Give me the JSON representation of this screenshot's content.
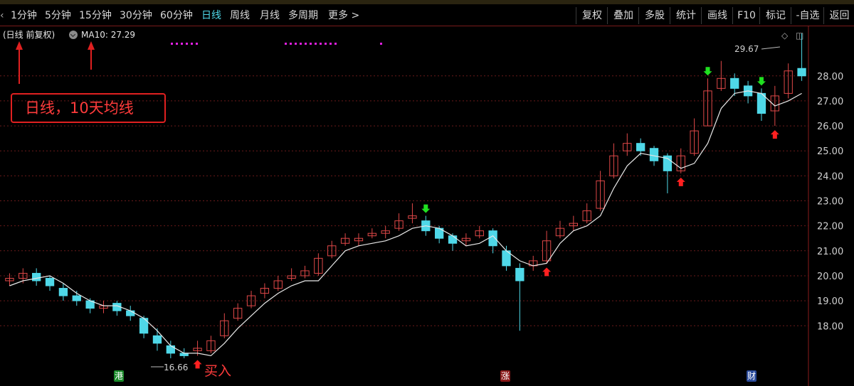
{
  "toolbar": {
    "periods": [
      {
        "label": "1分钟",
        "active": false
      },
      {
        "label": "5分钟",
        "active": false
      },
      {
        "label": "15分钟",
        "active": false
      },
      {
        "label": "30分钟",
        "active": false
      },
      {
        "label": "60分钟",
        "active": false
      },
      {
        "label": "日线",
        "active": true
      },
      {
        "label": "周线",
        "active": false
      },
      {
        "label": "月线",
        "active": false
      },
      {
        "label": "多周期",
        "active": false
      },
      {
        "label": "更多 >",
        "active": false
      }
    ],
    "tools": [
      "复权",
      "叠加",
      "多股",
      "统计",
      "画线",
      "F10",
      "标记",
      "-自选",
      "返回"
    ]
  },
  "chart_info": {
    "period_label": "(日线 前复权)",
    "ma_label": "MA10: 27.29"
  },
  "annotation": {
    "box_text": "日线，10天均线",
    "buy_text": "买入"
  },
  "markers": {
    "low_price": "16.66",
    "high_price": "29.67"
  },
  "badges": [
    {
      "text": "港",
      "color": "#1a8a2a"
    },
    {
      "text": "涨",
      "color": "#8a1a1a"
    },
    {
      "text": "财",
      "color": "#2a4a9a"
    }
  ],
  "colors": {
    "up": "#e04848",
    "down": "#4fd8e8",
    "ma": "#e8e8e8",
    "grid": "#6a1a1a",
    "buy_arrow": "#ff2020",
    "sell_arrow": "#20e020"
  },
  "chart_data": {
    "type": "candlestick",
    "y_ticks": [
      18.0,
      19.0,
      20.0,
      21.0,
      22.0,
      23.0,
      24.0,
      25.0,
      26.0,
      27.0,
      28.0
    ],
    "ylim": [
      16.3,
      29.9
    ],
    "series_ma": [
      19.6,
      19.8,
      19.9,
      20.0,
      19.7,
      19.3,
      19.0,
      18.8,
      18.8,
      18.6,
      18.3,
      17.8,
      17.2,
      16.9,
      16.9,
      16.8,
      17.3,
      17.9,
      18.4,
      18.9,
      19.3,
      19.6,
      19.8,
      19.8,
      20.4,
      21.0,
      21.2,
      21.3,
      21.4,
      21.6,
      21.9,
      22.0,
      21.9,
      21.6,
      21.2,
      21.3,
      21.6,
      21.0,
      20.6,
      20.4,
      20.5,
      21.3,
      21.8,
      22.0,
      22.4,
      23.5,
      24.4,
      24.9,
      24.8,
      24.7,
      24.3,
      24.5,
      25.3,
      26.7,
      27.3,
      27.4,
      27.3,
      26.8,
      27.0,
      27.3
    ],
    "candles_open": [
      19.8,
      19.9,
      20.1,
      19.9,
      19.5,
      19.2,
      19.0,
      18.7,
      18.9,
      18.6,
      18.3,
      17.6,
      17.2,
      16.9,
      17.0,
      17.0,
      17.6,
      18.3,
      18.8,
      19.3,
      19.5,
      19.9,
      20.0,
      20.1,
      20.8,
      21.3,
      21.4,
      21.6,
      21.7,
      21.9,
      22.3,
      22.2,
      21.9,
      21.6,
      21.4,
      21.6,
      21.8,
      21.0,
      20.3,
      20.4,
      20.6,
      21.6,
      22.0,
      22.2,
      22.7,
      24.0,
      25.0,
      25.3,
      25.1,
      24.8,
      24.2,
      24.9,
      26.0,
      27.5,
      27.9,
      27.6,
      27.3,
      26.6,
      27.3,
      28.3
    ],
    "candles_close": [
      19.9,
      20.1,
      19.8,
      19.6,
      19.2,
      19.0,
      18.7,
      18.8,
      18.6,
      18.4,
      17.7,
      17.3,
      16.9,
      16.8,
      17.1,
      17.4,
      18.2,
      18.7,
      19.2,
      19.5,
      19.8,
      20.0,
      20.2,
      20.7,
      21.2,
      21.5,
      21.5,
      21.7,
      21.8,
      22.2,
      22.4,
      21.8,
      21.5,
      21.3,
      21.5,
      21.8,
      21.2,
      20.4,
      19.8,
      20.6,
      21.4,
      21.9,
      22.1,
      22.6,
      23.8,
      24.8,
      25.3,
      25.0,
      24.6,
      24.2,
      24.8,
      25.8,
      27.4,
      27.9,
      27.5,
      27.2,
      26.5,
      27.2,
      28.2,
      28.0
    ],
    "candles_high": [
      20.1,
      20.3,
      20.3,
      20.0,
      19.7,
      19.4,
      19.1,
      19.0,
      19.0,
      18.8,
      18.4,
      17.9,
      17.4,
      17.1,
      17.4,
      17.6,
      18.5,
      18.9,
      19.4,
      19.7,
      20.0,
      20.3,
      20.4,
      20.9,
      21.4,
      21.7,
      21.7,
      21.9,
      22.0,
      22.5,
      22.9,
      22.4,
      22.0,
      21.7,
      21.7,
      22.0,
      21.9,
      21.2,
      20.5,
      20.8,
      21.8,
      22.2,
      22.4,
      22.9,
      24.2,
      25.3,
      25.7,
      25.5,
      25.2,
      24.9,
      25.1,
      26.3,
      27.9,
      28.6,
      28.1,
      27.8,
      27.5,
      27.6,
      28.5,
      29.7
    ],
    "candles_low": [
      19.6,
      19.7,
      19.6,
      19.4,
      19.0,
      18.8,
      18.5,
      18.5,
      18.4,
      18.2,
      17.5,
      17.0,
      16.7,
      16.7,
      16.8,
      16.9,
      17.5,
      18.2,
      18.7,
      19.1,
      19.4,
      19.8,
      19.9,
      20.0,
      20.7,
      21.2,
      21.2,
      21.5,
      21.5,
      21.8,
      22.1,
      21.6,
      21.3,
      21.0,
      21.2,
      21.5,
      20.9,
      20.2,
      17.8,
      20.2,
      20.5,
      21.5,
      21.8,
      22.1,
      22.6,
      23.9,
      24.8,
      24.8,
      24.4,
      23.3,
      24.1,
      24.8,
      26.0,
      27.4,
      27.2,
      26.9,
      26.2,
      26.0,
      27.1,
      27.8
    ],
    "arrows_sell": [
      31,
      52,
      56
    ],
    "arrows_buy": [
      14,
      40,
      50,
      57
    ]
  }
}
